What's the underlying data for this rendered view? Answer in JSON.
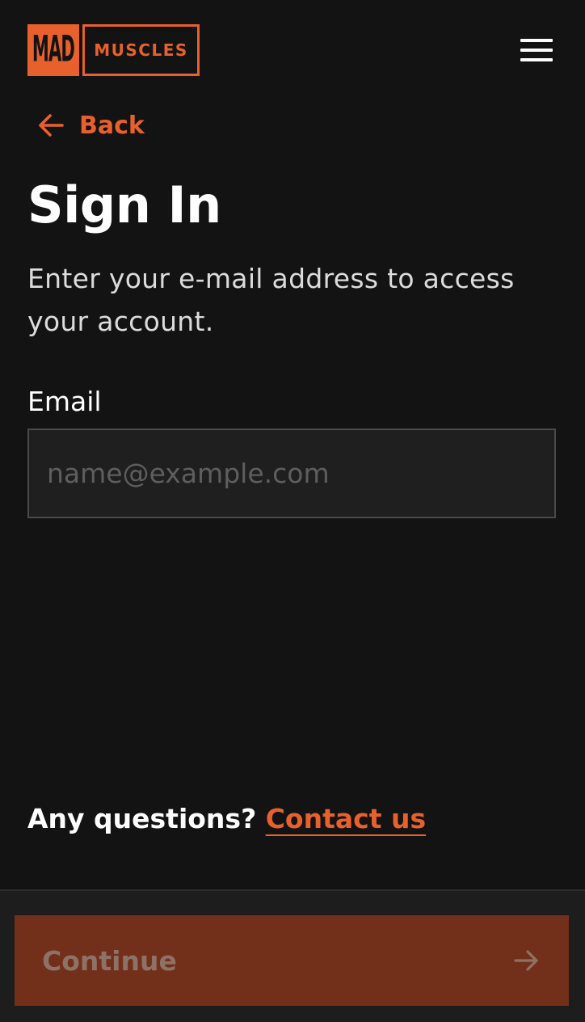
{
  "header": {
    "logo_left": "MAD",
    "logo_right": "MUSCLES",
    "menu_icon": "hamburger-menu-icon"
  },
  "nav": {
    "back_label": "Back",
    "back_icon": "arrow-left-icon"
  },
  "main": {
    "title": "Sign In",
    "subtitle": "Enter your e-mail address to access your account.",
    "email_label": "Email",
    "email_placeholder": "name@example.com",
    "email_value": ""
  },
  "help": {
    "question": "Any questions?",
    "contact_label": "Contact us"
  },
  "footer": {
    "continue_label": "Continue",
    "continue_icon": "arrow-right-icon",
    "continue_enabled": false
  },
  "colors": {
    "background": "#131313",
    "accent": "#e8612c",
    "button_disabled_bg": "#72301b",
    "button_disabled_text": "#8e7266",
    "input_bg": "#1f1f1f",
    "input_border": "#4a4a4a"
  }
}
